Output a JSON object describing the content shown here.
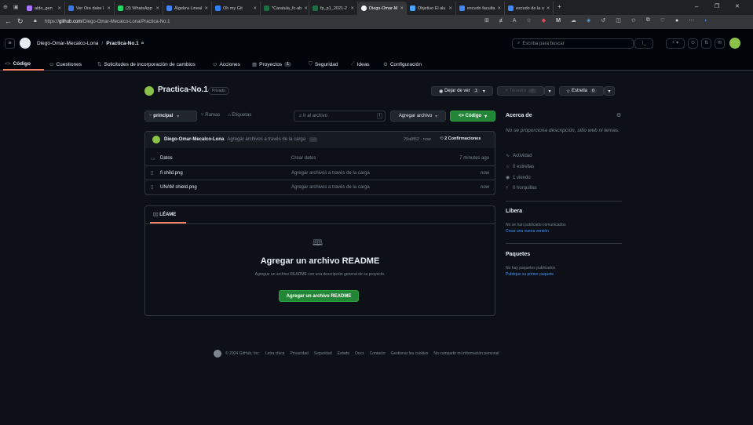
{
  "browser": {
    "tabs": [
      {
        "label": "aldo_gen",
        "color": "#a974ff"
      },
      {
        "label": "Ver Ore dake l",
        "color": "#3b78e7"
      },
      {
        "label": "(3) WhatsApp",
        "color": "#25d366"
      },
      {
        "label": "Álgebra Lineal",
        "color": "#4285f4"
      },
      {
        "label": "Oh my Git",
        "color": "#2f81f7"
      },
      {
        "label": "*Caratula_fc-ab",
        "color": "#1d6f42"
      },
      {
        "label": "fp_p1_2021-2",
        "color": "#1d6f42"
      },
      {
        "label": "Diego-Omar-M",
        "color": "#ffffff"
      },
      {
        "label": "Objetivo El alu",
        "color": "#4aa3ff"
      },
      {
        "label": "escudo faculta",
        "color": "#4285f4"
      },
      {
        "label": "escudo de la u",
        "color": "#4285f4"
      }
    ],
    "url_prefix": "https://",
    "url_host": "github.com",
    "url_path": "/Diego-Omar-Mecalco-Lona/Practica-No.1"
  },
  "header": {
    "owner": "Diego-Omar-Mecalco-Lona",
    "separator": "/",
    "repo": "Practica-No.1",
    "search_placeholder": "Escriba para buscar",
    "nav": [
      {
        "label": "Código",
        "active": true
      },
      {
        "label": "Cuestiones"
      },
      {
        "label": "Solicitudes de incorporación de cambios"
      },
      {
        "label": "Acciones"
      },
      {
        "label": "Proyectos",
        "count": "1"
      },
      {
        "label": "Seguridad"
      },
      {
        "label": "Ideas"
      },
      {
        "label": "Configuración"
      }
    ]
  },
  "repo": {
    "name": "Practica-No.1",
    "visibility": "Privado",
    "unwatch_label": "Dejar de ver",
    "unwatch_count": "1",
    "fork_label": "Tenedor",
    "fork_count": "0",
    "star_label": "Estrella",
    "star_count": "0",
    "branch": "principal",
    "branches_label": "Ramas",
    "tags_label": "Etiquetas",
    "goto_placeholder": "Ir al archivo",
    "goto_key": "t",
    "add_file": "Agregar archivo",
    "code_button": "Código"
  },
  "commit": {
    "author": "Diego-Omar-Mecalco-Lona",
    "message": "Agregar archivos a través de la carga",
    "hash_time": "29a8f62 · now",
    "commits": "2 Confirmaciones"
  },
  "files": [
    {
      "name": "Datos",
      "type": "folder",
      "message": "Crear datos",
      "time": "7 minutes ago"
    },
    {
      "name": "fi shild.png",
      "type": "file",
      "message": "Agregar archivos a través de la carga",
      "time": "now"
    },
    {
      "name": "UNAM shield.png",
      "type": "file",
      "message": "Agregar archivos a través de la carga",
      "time": "now"
    }
  ],
  "readme": {
    "tab": "LÉAME",
    "title": "Agregar un archivo README",
    "description": "Agregue un archivo README con una descripción general de su proyecto.",
    "button": "Agregar un archivo README"
  },
  "about": {
    "title": "Acerca de",
    "description": "No se proporciona descripción, sitio web ni temas.",
    "activity": "Actividad",
    "stars": "0 estrellas",
    "watching": "1 viendo",
    "forks": "0 horquillas"
  },
  "releases": {
    "title": "Libera",
    "text": "No se han publicado comunicados",
    "link": "Crear una nueva versión"
  },
  "packages": {
    "title": "Paquetes",
    "text": "No hay paquetes publicados",
    "link": "Publique su primer paquete"
  },
  "footer": {
    "copyright": "© 2024 GitHub, Inc.",
    "links": [
      "Letra chica",
      "Privacidad",
      "Seguridad",
      "Estado",
      "Docs",
      "Contacto",
      "Gestionar las cookies",
      "No compartir mi información personal"
    ]
  }
}
